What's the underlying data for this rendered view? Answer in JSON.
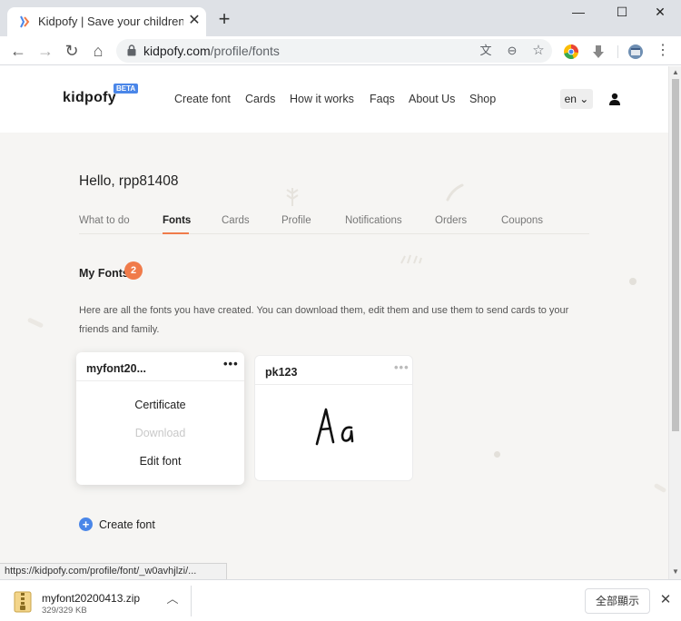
{
  "browser": {
    "tab_title": "Kidpofy | Save your children's d",
    "tab_close": "✕",
    "new_tab": "+",
    "window_controls": {
      "minimize": "—",
      "maximize": "☐",
      "close": "✕"
    },
    "url_host": "kidpofy.com",
    "url_path": "/profile/fonts",
    "status_url": "https://kidpofy.com/profile/font/_w0avhjlzi/..."
  },
  "site": {
    "logo": "kidpofy",
    "beta": "BETA",
    "nav": [
      "Create font",
      "Cards",
      "How it works",
      "Faqs",
      "About Us",
      "Shop"
    ],
    "language": "en ⌄"
  },
  "profile": {
    "greeting": "Hello, rpp81408",
    "tabs": [
      "What to do",
      "Fonts",
      "Cards",
      "Profile",
      "Notifications",
      "Orders",
      "Coupons"
    ],
    "active_tab": "Fonts",
    "section_title": "My Fonts",
    "font_count": "2",
    "description": "Here are all the fonts you have created. You can download them, edit them and use them to send cards to your friends and family."
  },
  "fonts": [
    {
      "name": "myfont20...",
      "more": "•••",
      "menu": [
        "Certificate",
        "Download",
        "Edit font"
      ]
    },
    {
      "name": "pk123",
      "more": "•••",
      "preview": "Aa"
    }
  ],
  "create_font_label": "Create font",
  "download": {
    "file_name": "myfont20200413.zip",
    "file_size": "329/329 KB",
    "show_all": "全部顯示",
    "close": "✕"
  },
  "colors": {
    "accent_orange": "#f07b4a",
    "accent_blue": "#4a86e8",
    "page_bg": "#f6f5f3"
  }
}
